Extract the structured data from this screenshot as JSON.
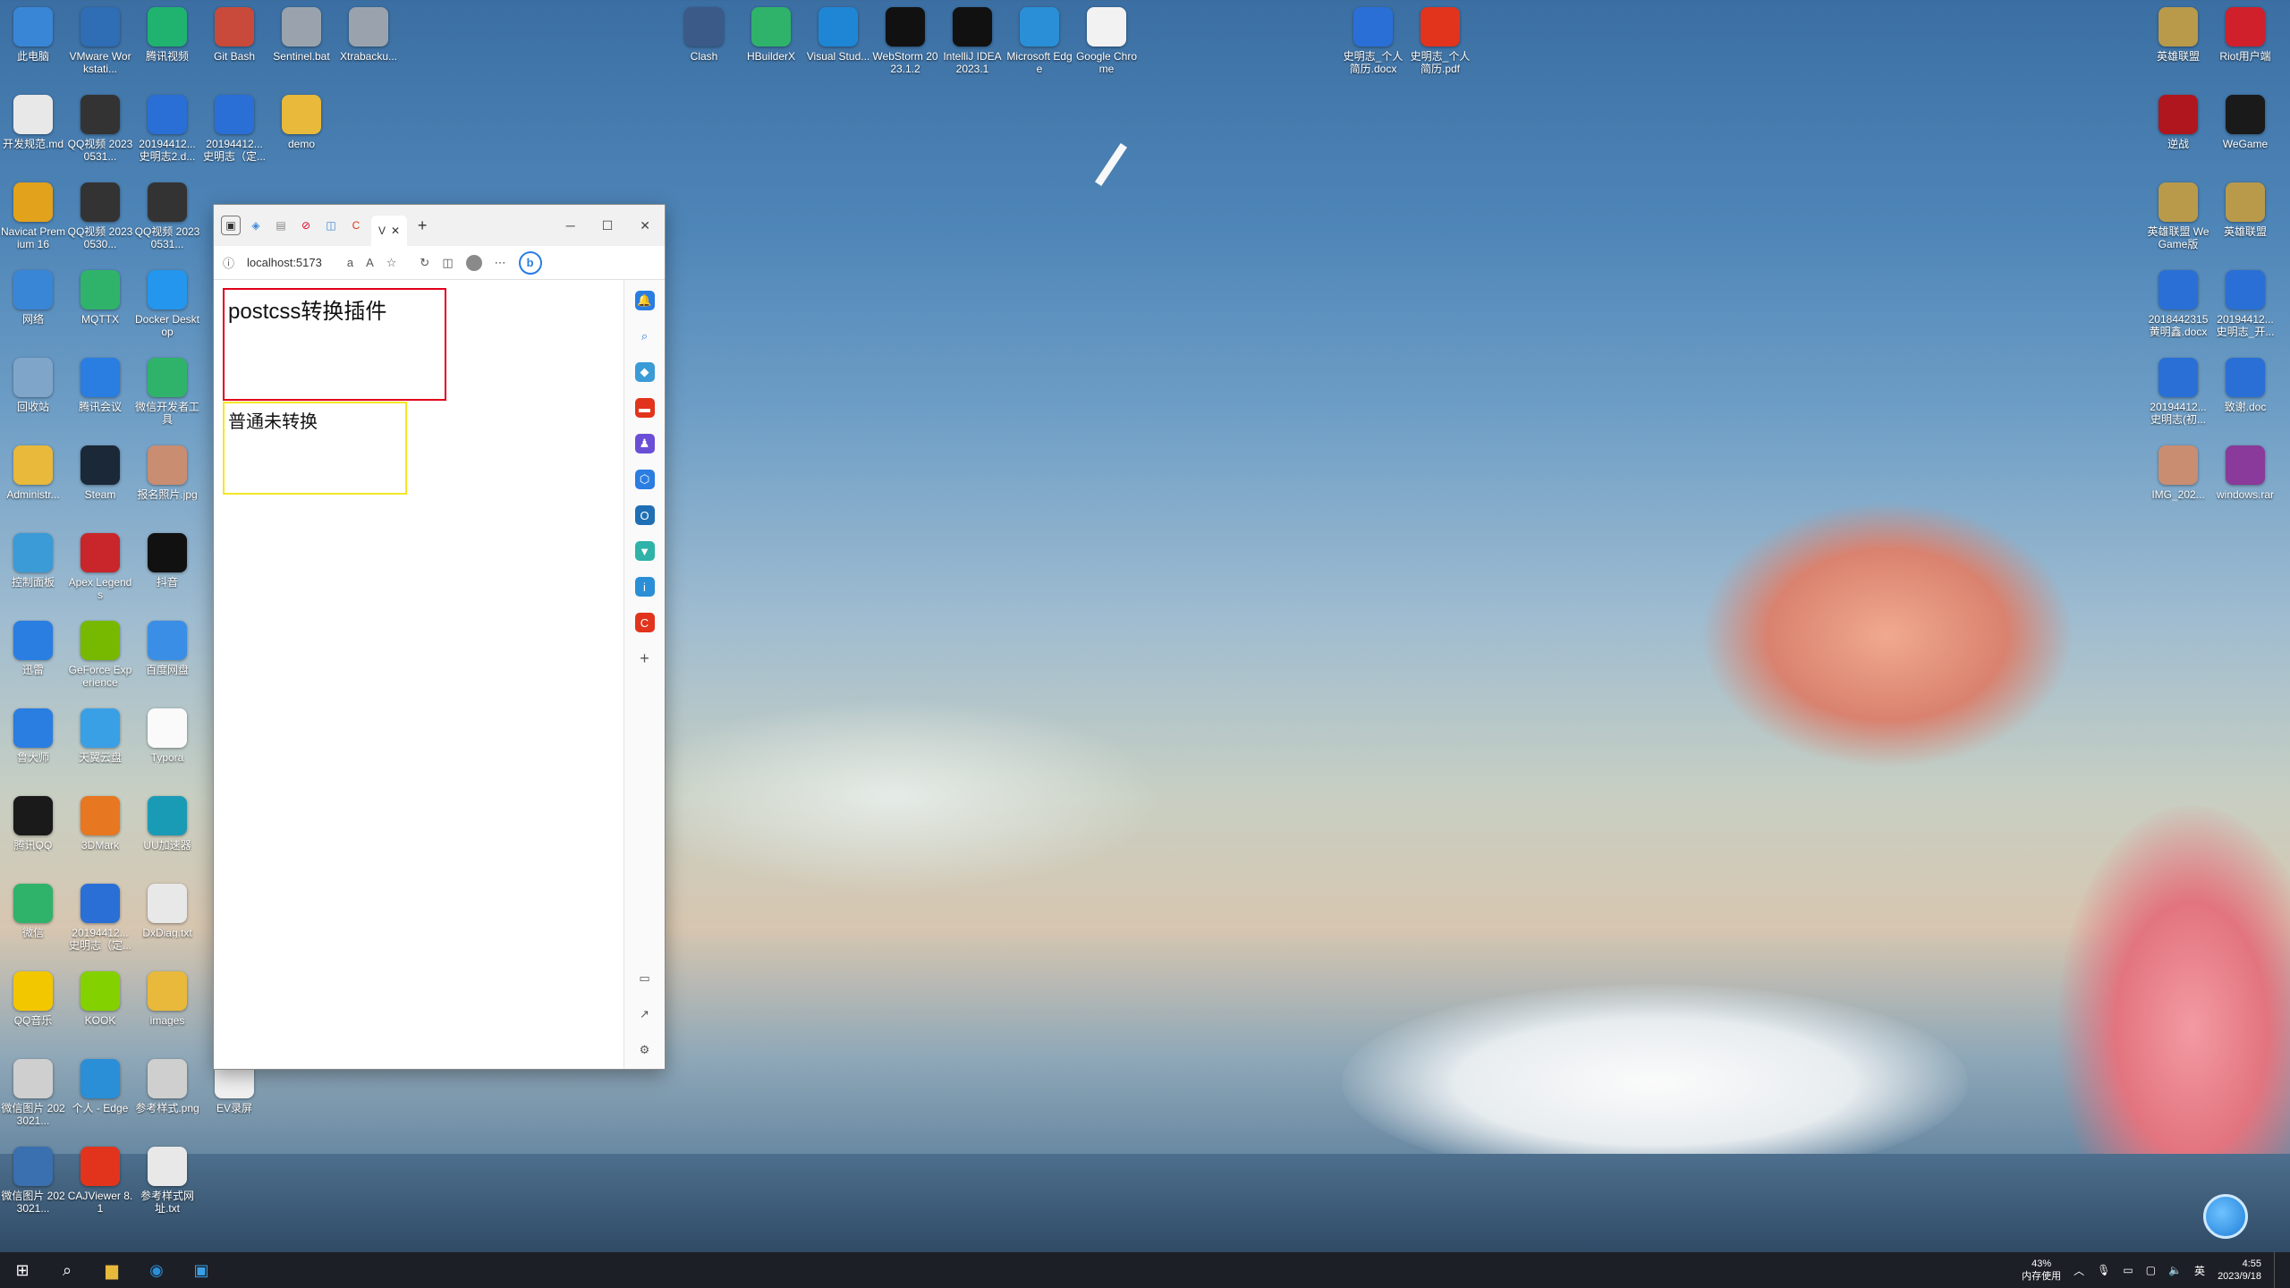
{
  "colors": {
    "accent_red_box": "#e2001a",
    "accent_yellow_box": "#f5e625",
    "taskbar_bg": "#1c1f26"
  },
  "desktop_icons": [
    {
      "label": "此电脑",
      "icon": "computer-icon",
      "color": "#3a86d6"
    },
    {
      "label": "VMware Workstati...",
      "icon": "vmware-icon",
      "color": "#2f6db5"
    },
    {
      "label": "腾讯视频",
      "icon": "tencent-video-icon",
      "color": "#1fb36f"
    },
    {
      "label": "Git Bash",
      "icon": "git-icon",
      "color": "#c94a3a"
    },
    {
      "label": "Sentinel.bat",
      "icon": "bat-file-icon",
      "color": "#9aa3ad"
    },
    {
      "label": "Xtrabacku...",
      "icon": "bat-file-icon",
      "color": "#9aa3ad"
    },
    {
      "label": "开发规范.md",
      "icon": "md-file-icon",
      "color": "#e8e8e8"
    },
    {
      "label": "QQ视频 20230531...",
      "icon": "video-file-icon",
      "color": "#333"
    },
    {
      "label": "20194412... 史明志2.d...",
      "icon": "word-icon",
      "color": "#2a6fd6"
    },
    {
      "label": "20194412... 史明志（定...",
      "icon": "word-icon",
      "color": "#2a6fd6"
    },
    {
      "label": "demo",
      "icon": "folder-icon",
      "color": "#e8b93a"
    },
    {
      "label": "Navicat Premium 16",
      "icon": "navicat-icon",
      "color": "#e2a21b"
    },
    {
      "label": "QQ视频 20230530...",
      "icon": "video-file-icon",
      "color": "#333"
    },
    {
      "label": "QQ视频 20230531...",
      "icon": "video-file-icon",
      "color": "#333"
    },
    {
      "label": "网络",
      "icon": "network-icon",
      "color": "#3a86d6"
    },
    {
      "label": "MQTTX",
      "icon": "mqttx-icon",
      "color": "#2fb36a"
    },
    {
      "label": "Docker Desktop",
      "icon": "docker-icon",
      "color": "#2496ed"
    },
    {
      "label": "回收站",
      "icon": "recycle-bin-icon",
      "color": "#7fa6c9"
    },
    {
      "label": "腾讯会议",
      "icon": "tencent-meeting-icon",
      "color": "#2a7de1"
    },
    {
      "label": "微信开发者工具",
      "icon": "wechat-devtools-icon",
      "color": "#2fb36a"
    },
    {
      "label": "Administr...",
      "icon": "user-folder-icon",
      "color": "#e8b93a"
    },
    {
      "label": "Steam",
      "icon": "steam-icon",
      "color": "#1b2838"
    },
    {
      "label": "报名照片.jpg",
      "icon": "image-file-icon",
      "color": "#c98d72"
    },
    {
      "label": "控制面板",
      "icon": "control-panel-icon",
      "color": "#3a9bd6"
    },
    {
      "label": "Apex Legends",
      "icon": "apex-icon",
      "color": "#c8262b"
    },
    {
      "label": "抖音",
      "icon": "douyin-icon",
      "color": "#111"
    },
    {
      "label": "迅雷",
      "icon": "xunlei-icon",
      "color": "#2a7de1"
    },
    {
      "label": "GeForce Experience",
      "icon": "nvidia-icon",
      "color": "#76b900"
    },
    {
      "label": "百度网盘",
      "icon": "baidu-netdisk-icon",
      "color": "#3a8ee6"
    },
    {
      "label": "鲁大师",
      "icon": "ludashi-icon",
      "color": "#2a7de1"
    },
    {
      "label": "天翼云盘",
      "icon": "tianyi-cloud-icon",
      "color": "#3aa0e6"
    },
    {
      "label": "Typora",
      "icon": "typora-icon",
      "color": "#fafafa"
    },
    {
      "label": "腾讯QQ",
      "icon": "qq-icon",
      "color": "#1a1a1a"
    },
    {
      "label": "3DMark",
      "icon": "3dmark-icon",
      "color": "#e87722"
    },
    {
      "label": "UU加速器",
      "icon": "uu-icon",
      "color": "#1a9bb5"
    },
    {
      "label": "微信",
      "icon": "wechat-icon",
      "color": "#2fb36a"
    },
    {
      "label": "20194412... 史明志（定...",
      "icon": "word-icon",
      "color": "#2a6fd6"
    },
    {
      "label": "DxDiag.txt",
      "icon": "txt-file-icon",
      "color": "#e8e8e8"
    },
    {
      "label": "QQ音乐",
      "icon": "qq-music-icon",
      "color": "#f2c700"
    },
    {
      "label": "KOOK",
      "icon": "kook-icon",
      "color": "#84d100"
    },
    {
      "label": "images",
      "icon": "folder-icon",
      "color": "#e8b93a"
    },
    {
      "label": "微信图片 2023021...",
      "icon": "image-file-icon",
      "color": "#cfcfcf"
    },
    {
      "label": "个人 - Edge",
      "icon": "edge-icon",
      "color": "#2a8fd6"
    },
    {
      "label": "参考样式.png",
      "icon": "image-file-icon",
      "color": "#cfcfcf"
    },
    {
      "label": "EV录屏",
      "icon": "ev-recorder-icon",
      "color": "#f0f0f0"
    },
    {
      "label": "微信图片 2023021...",
      "icon": "image-file-icon",
      "color": "#3a6fb0"
    },
    {
      "label": "CAJViewer 8.1",
      "icon": "caj-icon",
      "color": "#e2341d"
    },
    {
      "label": "参考样式网址.txt",
      "icon": "txt-file-icon",
      "color": "#e8e8e8"
    },
    {
      "label": "Clash",
      "icon": "clash-icon",
      "color": "#3b5a88"
    },
    {
      "label": "HBuilderX",
      "icon": "hbuilder-icon",
      "color": "#2fb36a"
    },
    {
      "label": "Visual Stud...",
      "icon": "vscode-icon",
      "color": "#1f86d6"
    },
    {
      "label": "WebStorm 2023.1.2",
      "icon": "webstorm-icon",
      "color": "#111"
    },
    {
      "label": "IntelliJ IDEA 2023.1",
      "icon": "idea-icon",
      "color": "#111"
    },
    {
      "label": "Microsoft Edge",
      "icon": "edge-icon",
      "color": "#2a8fd6"
    },
    {
      "label": "Google Chrome",
      "icon": "chrome-icon",
      "color": "#f2f2f2"
    },
    {
      "label": "史明志_个人简历.docx",
      "icon": "word-icon",
      "color": "#2a6fd6"
    },
    {
      "label": "史明志_个人简历.pdf",
      "icon": "pdf-icon",
      "color": "#e2341d"
    },
    {
      "label": "英雄联盟",
      "icon": "lol-icon",
      "color": "#b89a4a"
    },
    {
      "label": "Riot用户端",
      "icon": "riot-icon",
      "color": "#d0202c"
    },
    {
      "label": "逆战",
      "icon": "nizhan-icon",
      "color": "#b0161e"
    },
    {
      "label": "WeGame",
      "icon": "wegame-icon",
      "color": "#1a1a1a"
    },
    {
      "label": "英雄联盟 WeGame版",
      "icon": "lol-icon",
      "color": "#b89a4a"
    },
    {
      "label": "英雄联盟",
      "icon": "lol-icon",
      "color": "#b89a4a"
    },
    {
      "label": "2018442315 黄明鑫.docx",
      "icon": "word-icon",
      "color": "#2a6fd6"
    },
    {
      "label": "20194412... 史明志_开...",
      "icon": "word-icon",
      "color": "#2a6fd6"
    },
    {
      "label": "20194412... 史明志(初...",
      "icon": "word-icon",
      "color": "#2a6fd6"
    },
    {
      "label": "致谢.doc",
      "icon": "word-icon",
      "color": "#2a6fd6"
    },
    {
      "label": "IMG_202...",
      "icon": "image-file-icon",
      "color": "#c98d72"
    },
    {
      "label": "windows.rar",
      "icon": "rar-icon",
      "color": "#8a3a9a"
    }
  ],
  "browser": {
    "address": "localhost:5173",
    "tab_label": "V",
    "new_tab": "+",
    "content": {
      "box1_text": "postcss转换插件",
      "box2_text": "普通未转换"
    }
  },
  "taskbar": {
    "memory_percent": "43%",
    "memory_label": "内存使用",
    "ime": "英",
    "time": "4:55",
    "date": "2023/9/18"
  }
}
